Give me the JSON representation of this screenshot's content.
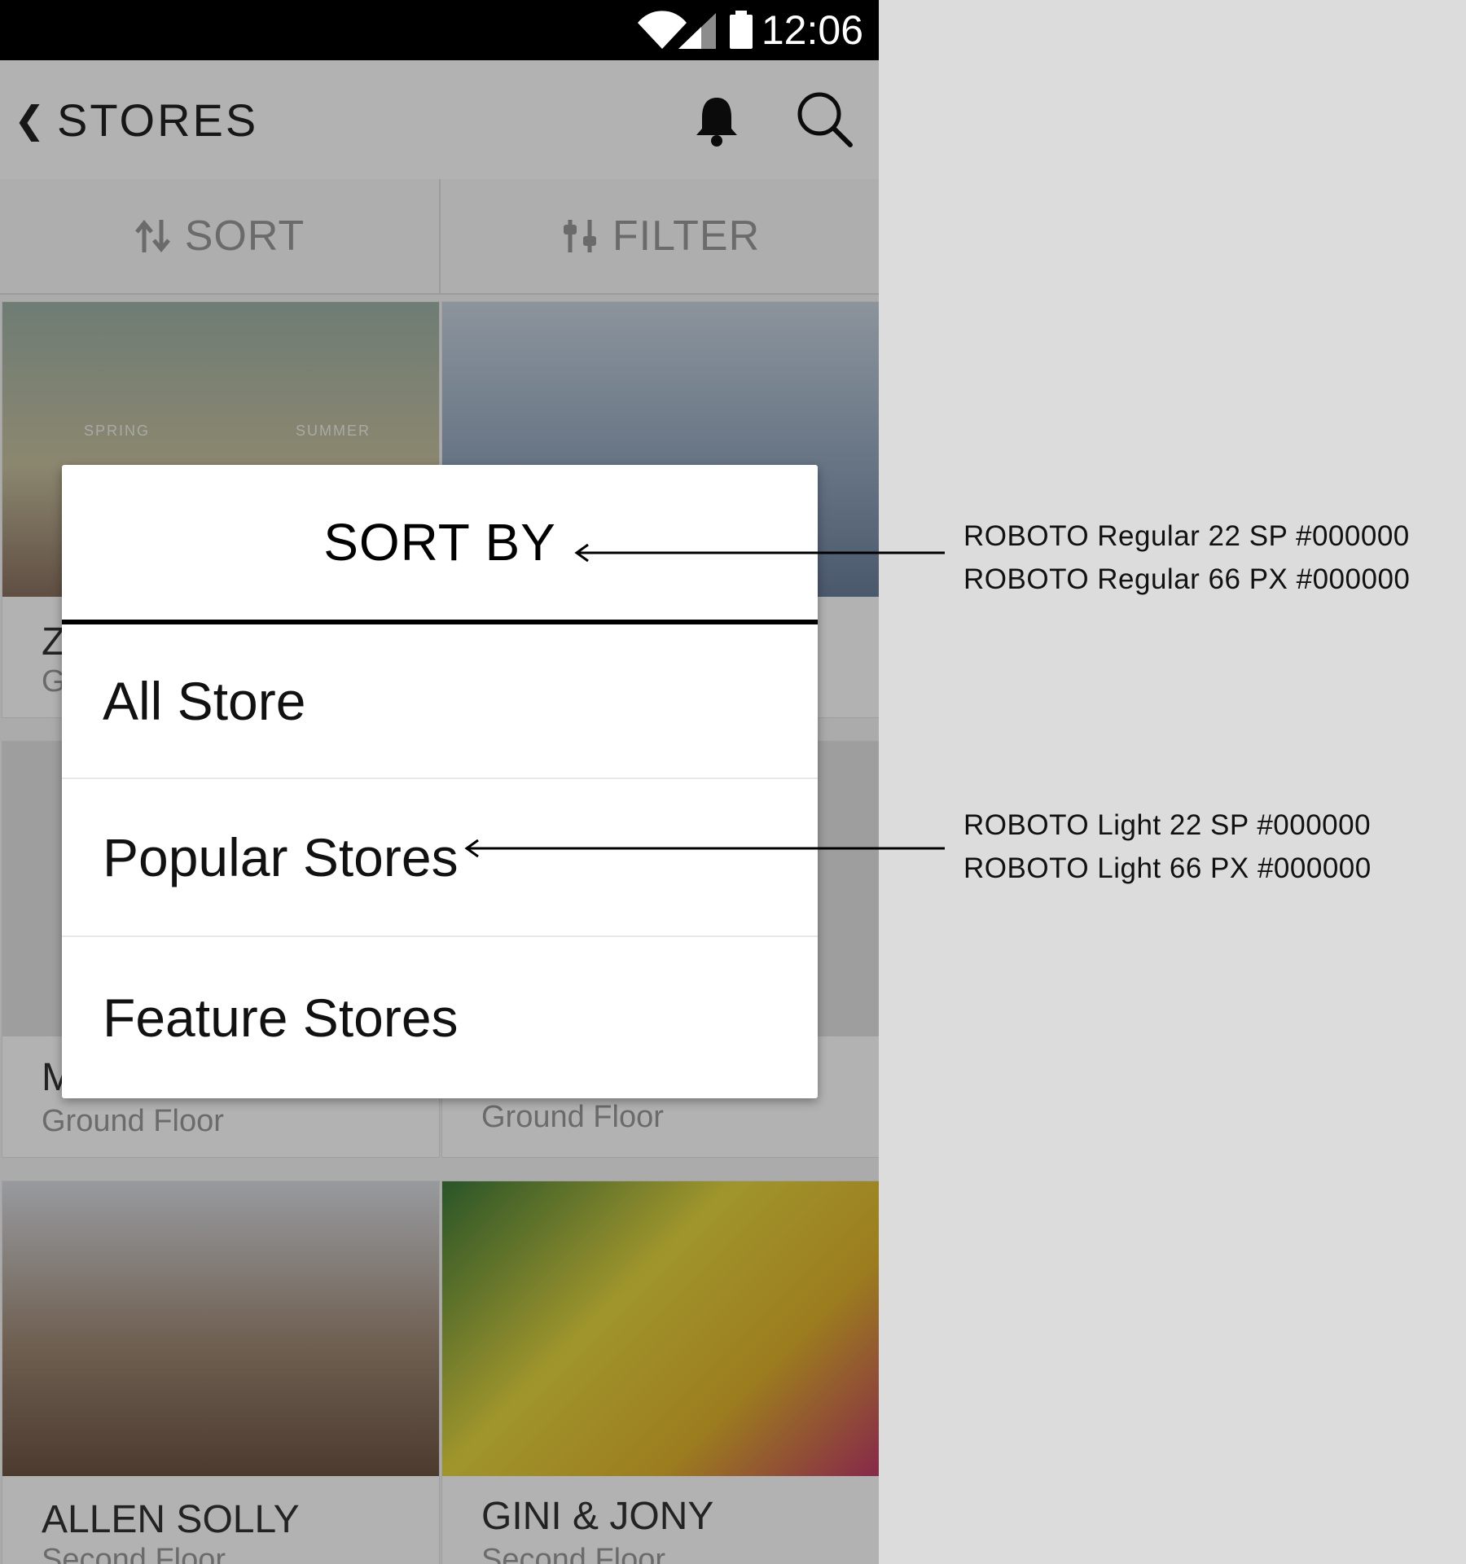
{
  "status_bar": {
    "time": "12:06",
    "icons": [
      "wifi-icon",
      "signal-icon",
      "battery-icon"
    ]
  },
  "app_bar": {
    "back_glyph": "❮",
    "title": "STORES",
    "icons": [
      "notification-bell-icon",
      "search-icon"
    ]
  },
  "tabs": [
    {
      "label": "SORT",
      "icon": "sort-arrows-icon"
    },
    {
      "label": "FILTER",
      "icon": "filter-sliders-icon"
    }
  ],
  "store_cards": [
    {
      "name": "Z",
      "floor": "G",
      "image_text": [
        "SPRING",
        "SUMMER"
      ]
    },
    {
      "name": "",
      "floor": ""
    },
    {
      "name": "M",
      "floor": "Ground Floor"
    },
    {
      "name": "",
      "floor": "Ground Floor"
    },
    {
      "name": "ALLEN SOLLY",
      "floor": "Second Floor"
    },
    {
      "name": "GINI & JONY",
      "floor": "Second Floor"
    }
  ],
  "dialog": {
    "title": "SORT BY",
    "options": [
      "All Store",
      "Popular Stores",
      "Feature Stores"
    ]
  },
  "annotations": {
    "title_spec": [
      "ROBOTO Regular 22 SP #000000",
      "ROBOTO Regular 66 PX #000000"
    ],
    "option_spec": [
      "ROBOTO Light 22 SP #000000",
      "ROBOTO Light 66 PX #000000"
    ]
  },
  "colors": {
    "scrim": "#000000",
    "dialog_bg": "#ffffff",
    "text": "#000000",
    "page_bg": "#dcdcdc"
  }
}
